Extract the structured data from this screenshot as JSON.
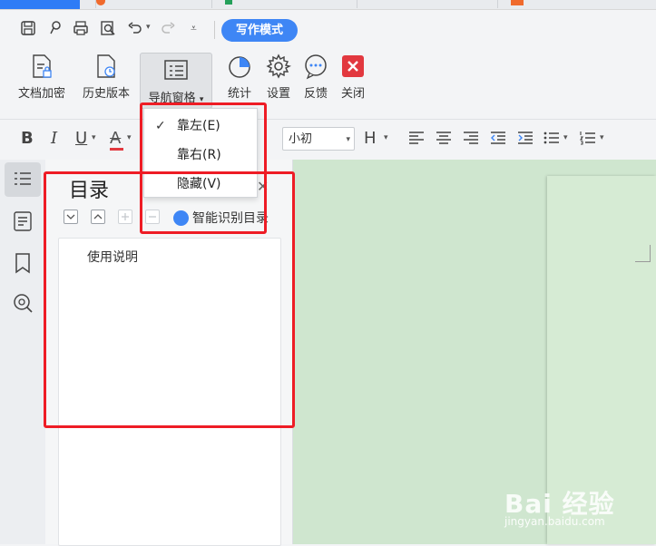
{
  "toolbar": {
    "write_mode_label": "写作模式"
  },
  "ribbon": {
    "doc_encrypt": "文档加密",
    "history": "历史版本",
    "nav_pane": "导航窗格",
    "stats": "统计",
    "settings": "设置",
    "feedback": "反馈",
    "close": "关闭"
  },
  "format": {
    "bold": "B",
    "italic": "I",
    "underline": "U",
    "font_color": "A",
    "heading": "H",
    "font_size": "小初"
  },
  "dropdown": {
    "items": [
      {
        "label": "靠左(E)",
        "checked": true
      },
      {
        "label": "靠右(R)",
        "checked": false
      },
      {
        "label": "隐藏(V)",
        "checked": false
      }
    ]
  },
  "nav_pane": {
    "title": "目录",
    "smart_toc": "智能识别目录",
    "entries": [
      "使用说明"
    ]
  },
  "watermark": {
    "logo": "Bai 经验",
    "url": "jingyan.baidu.com"
  },
  "colors": {
    "accent": "#3e86f5",
    "annotation_red": "#ee1c25",
    "document_bg": "#cfe6cf"
  }
}
